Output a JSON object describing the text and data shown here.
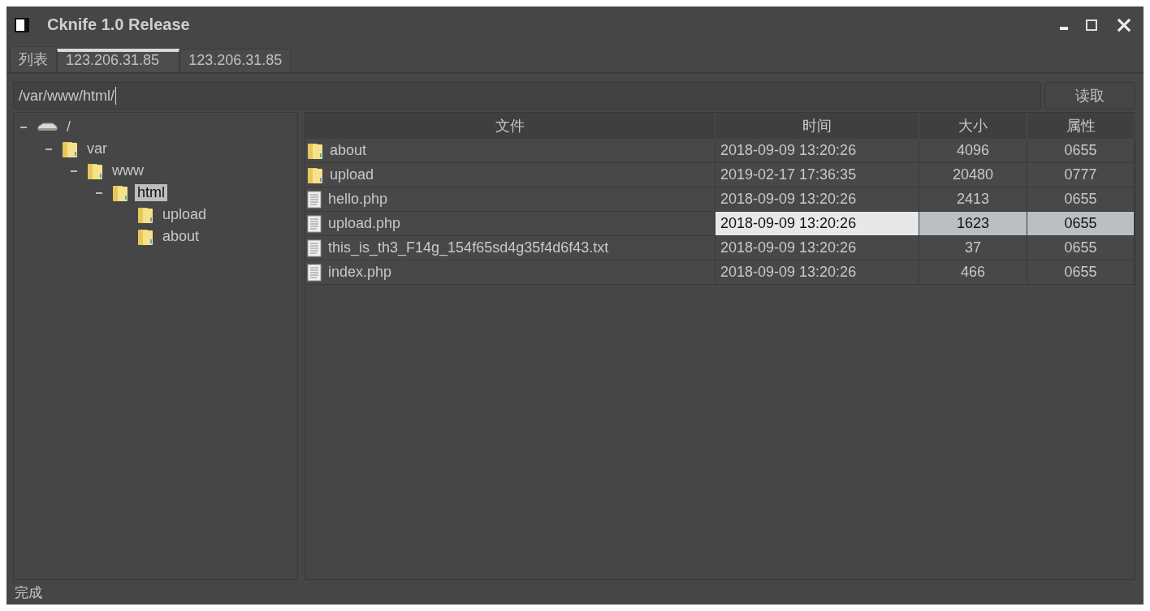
{
  "window": {
    "title": "Cknife 1.0 Release"
  },
  "tabs": [
    {
      "label": "列表",
      "selected": false
    },
    {
      "label": "123.206.31.85",
      "selected": true
    },
    {
      "label": "123.206.31.85",
      "selected": false
    }
  ],
  "path_field": {
    "value": "/var/www/html/"
  },
  "read_button": {
    "label": "读取"
  },
  "tree": [
    {
      "label": "/",
      "kind": "drive",
      "expanded": true,
      "selected": false,
      "children": [
        {
          "label": "var",
          "kind": "folder",
          "expanded": true,
          "selected": false,
          "children": [
            {
              "label": "www",
              "kind": "folder",
              "expanded": true,
              "selected": false,
              "children": [
                {
                  "label": "html",
                  "kind": "folder",
                  "expanded": true,
                  "selected": true,
                  "children": [
                    {
                      "label": "upload",
                      "kind": "folder",
                      "selected": false
                    },
                    {
                      "label": "about",
                      "kind": "folder",
                      "selected": false
                    }
                  ]
                }
              ]
            }
          ]
        }
      ]
    }
  ],
  "table": {
    "columns": [
      "文件",
      "时间",
      "大小",
      "属性"
    ],
    "rows": [
      {
        "kind": "folder",
        "name": "about",
        "time": "2018-09-09 13:20:26",
        "size": "4096",
        "attr": "0655",
        "selected": false
      },
      {
        "kind": "folder",
        "name": "upload",
        "time": "2019-02-17 17:36:35",
        "size": "20480",
        "attr": "0777",
        "selected": false
      },
      {
        "kind": "file",
        "name": "hello.php",
        "time": "2018-09-09 13:20:26",
        "size": "2413",
        "attr": "0655",
        "selected": false
      },
      {
        "kind": "file",
        "name": "upload.php",
        "time": "2018-09-09 13:20:26",
        "size": "1623",
        "attr": "0655",
        "selected": true
      },
      {
        "kind": "file",
        "name": "this_is_th3_F14g_154f65sd4g35f4d6f43.txt",
        "time": "2018-09-09 13:20:26",
        "size": "37",
        "attr": "0655",
        "selected": false
      },
      {
        "kind": "file",
        "name": "index.php",
        "time": "2018-09-09 13:20:26",
        "size": "466",
        "attr": "0655",
        "selected": false
      }
    ]
  },
  "status_bar": {
    "text": "完成"
  }
}
